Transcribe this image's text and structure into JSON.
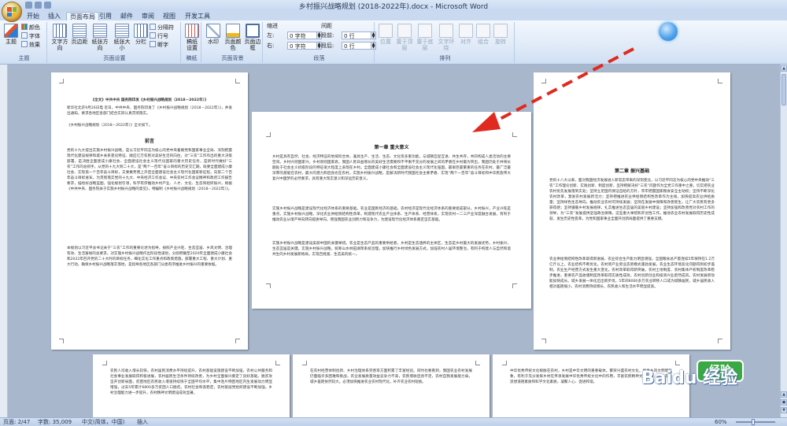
{
  "window": {
    "title": "乡村振兴战略规划 (2018-2022年).docx - Microsoft Word"
  },
  "tabs": [
    "开始",
    "插入",
    "页面布局",
    "引用",
    "邮件",
    "审阅",
    "视图",
    "开发工具"
  ],
  "active_tab": "页面布局",
  "ribbon": {
    "theme_group": {
      "name": "主题",
      "big_label": "主题",
      "colors": "颜色",
      "fonts": "字体",
      "effects": "效果"
    },
    "page_setup": {
      "name": "页面设置",
      "text_direction": "文字方向",
      "margins": "页边距",
      "orientation": "纸张方向",
      "size": "纸张大小",
      "columns": "分栏",
      "breaks": "分隔符",
      "line_numbers": "行号",
      "hyphenation": "断字"
    },
    "manuscript": {
      "name": "稿纸",
      "label": "稿纸设置"
    },
    "page_background": {
      "name": "页面背景",
      "watermark": "水印",
      "page_color": "页面颜色",
      "page_borders": "页面边框"
    },
    "paragraph": {
      "name": "段落",
      "indent_header": "缩进",
      "spacing_header": "间距",
      "left_label": "左:",
      "left_value": "0 字符",
      "right_label": "右:",
      "right_value": "0 字符",
      "before_label": "段前:",
      "before_value": "0 行",
      "after_label": "段后:",
      "after_value": "0 行"
    },
    "arrange": {
      "name": "排列",
      "position": "位置",
      "bring_front": "置于顶层",
      "send_back": "置于底层",
      "text_wrap": "文字环绕",
      "align": "对齐",
      "group": "组合",
      "rotate": "旋转"
    }
  },
  "pages": {
    "p1": {
      "header_line": "《全文》中共中央 国务院印发《乡村振兴战略规划（2018－2022年）》",
      "intro": "新华社北京9月26日电 近日，中共中央、国务院印发了《乡村振兴战略规划（2018－2022年）》，并发出通知，要求各地区各部门结合实际认真贯彻落实。",
      "intro2": "《乡村振兴战略规划（2018－2022年）》全文如下。",
      "heading": "前言",
      "body": "党的十九大提出实施乡村振兴战略，是以习近平同志为核心的党中央着眼党和国家事业全局、深刻把握现代化建设规律和城乡关系变化特征、顺应亿万农民对美好生活的向往，对“三农”工作作出的重大决策部署，是决胜全面建成小康社会、全面建设社会主义现代化国家的重大历史任务，是新时代做好“三农”工作的总抓手。从党的十九大到二十大，是“两个一百年”奋斗目标的历史交汇期，既要全面建成小康社会、实现第一个百年奋斗目标，又要乘势而上开启全面建设社会主义现代化国家新征程，向第二个百年奋斗目标进军。为贯彻落实党的十九大、中央经济工作会议、中央农村工作会议精神和政府工作报告要求，描绘好战略蓝图，强化规划引领，科学有序推动乡村产业、人才、文化、生态和组织振兴，根据《中共中央、国务院关于实施乡村振兴战略的意见》，特编制《乡村振兴战略规划（2018－2022年）》。",
      "body2": "本规划以习近平总书记关于“三农”工作的重要论述为指导，按照产业兴旺、生态宜居、乡风文明、治理有效、生活富裕的总要求，对实施乡村振兴战略作出阶段性谋划，分别明确至2020年全面建成小康社会和2022年召开党的二十大时的目标任务，细化实化工作重点和政策措施，部署重大工程、重大计划、重大行动，确保乡村振兴战略落实落地，是指导各地区各部门分类有序推进乡村振兴的重要依据。"
    },
    "p2": {
      "heading": "第一章 重大意义",
      "body": "乡村是具有自然、社会、经济特征的地域综合体，兼具生产、生活、生态、文化等多重功能，与城镇互促互进、共生共存，共同构成人类活动的主要空间。乡村兴则国家兴，乡村衰则国家衰。我国人民日益增长的美好生活需要和不平衡不充分的发展之间的矛盾在乡村最为突出，我国仍处于并将长期处于社会主义初级阶段的特征很大程度上表现在乡村。全面建成小康社会和全面建设社会主义现代化强国，最艰巨最繁重的任务在农村，最广泛最深厚的基础在农村，最大的潜力和后劲也在农村。实施乡村振兴战略，是解决新时代我国社会主要矛盾、实现“两个一百年”奋斗目标和中华民族伟大复兴中国梦的必然要求，具有重大现实意义和深远历史意义。",
      "body2": "实施乡村振兴战略是建设现代化经济体系的重要基础。农业是国民经济的基础，农村经济是现代化经济体系的重要组成部分。乡村振兴，产业兴旺是重点。实施乡村振兴战略，深化农业供给侧结构性改革，构建现代农业产业体系、生产体系、经营体系，实现农村一二三产业深度融合发展，有利于推动农业从增产导向转向提质导向，增强我国农业创新力和竞争力，为建设现代化经济体系奠定坚实基础。",
      "body3": "实施乡村振兴战略是建设美丽中国的关键举措。农业是生态产品的重要供给者，乡村是生态涵养的主体区，生态是乡村最大的发展优势。乡村振兴，生态宜居是关键。实施乡村振兴战略，统筹山水林田湖草系统治理，加快推行乡村绿色发展方式，加强农村人居环境整治，有利于构建人与自然和谐共生的乡村发展新格局，实现百姓富、生态美的统一。"
    },
    "p3": {
      "heading": "第二章 振兴基础",
      "body": "党的十八大以来，面对我国经济发展进入新常态带来的深刻变化，以习近平同志为核心的党中央推动“三农”工作理论创新、实践创新、制度创新，坚持把解决好“三农”问题作为全党工作重中之重，切实把农业农村优先发展落到实处；坚持立足国内保证自给的方针，牢牢把握国家粮食安全主动权；坚持不断深化农村改革，激发农村发展新活力；坚持把推进农业供给侧结构性改革作为主线，加快提高农业供给质量；坚持绿色生态导向，推动农业农村可持续发展；坚持在发展中保障和改善民生，让广大农民有更多获得感；坚持遵循乡村发展规律，扎实推进生态宜居的美丽乡村建设；坚持加强和改善党对农村工作的领导，为“三农”发展提供坚强政治保障。这些重大举措和开创性工作，推动农业农村发展取得历史性成就、发生历史性变革，为党和国家事业全面开创新局面提供了重要支撑。",
      "body2": "农业供给侧结构性改革取得新进展，农业综合生产能力明显增强，全国粮食总产量连续5年保持在1.2万亿斤以上，农业结构不断优化，农村新产业新业态新模式蓬勃发展，农业生态环境恶化问题得到初步遏制，农业生产经营方式发生重大变化。农村改革取得新突破，农村土地制度、农村集体产权制度改革稳步推进，重要农产品收储制度改革取得实质性成效，农村创新创业和投资兴业蔚然成风，农村发展新动能加快成长。城乡发展一体化迈出新步伐，5年间8000多万农业转移人口成为城镇居民，城乡居民收入相对差距缩小，农村消费持续增长，农民收入和生活水平明显提高。"
    },
    "p4": {
      "body": "农民人均收入增长较快，农村居民消费水平持续提升，农村基础设施建设不断加强，农村公共服务和社会事业发展取得积极进展，农村居民生活条件持续改善，为乡村全面振兴奠定了良好基础。脱贫攻坚开创新局面，贫困地区农民收入增速持续快于全国平均水平，集中连片特困地区内生发展动力明显增强，过去5年累计6800多万贫困人口脱贫。农村社会和谐稳定，农村基层党组织建设不断加强，乡村治理能力进一步提升，农村精神文明建设成效显著。"
    },
    "p5": {
      "body": "在农村经营体制创新、乡村治理体系完善等方面积累了丰富经验。同时也要看到，我国农业农村发展仍面临许多困难和挑战，农业发展质量效益竞争力不高，农民增收后劲不足，农村自我发展能力弱，城乡差距依然较大。必须加快推进农业农村现代化，补齐农业农村短板。"
    },
    "p6": {
      "body": "中华优秀传统文化根脉在农村，乡村是中华文明的重要载体。繁荣兴盛农村文化，焕发乡风文明新气象，有利于充分发挥乡村在传承发展中华优秀传统文化中的作用，丰富农民精神文化生活，提高农民思想道德素质和科学文化素质，凝聚人心、促进和谐。"
    }
  },
  "status": {
    "page": "页面: 2/47",
    "words": "字数: 35,009",
    "language": "中文(简体，中国)",
    "mode": "插入",
    "zoom": "60%"
  },
  "watermark_text": "Baidu 经验",
  "watermark_badge": "经验",
  "colors": {
    "arrow": "#e02a1f",
    "ribbon_bg": "#dce8f7",
    "doc_bg": "#a9b7cc"
  }
}
